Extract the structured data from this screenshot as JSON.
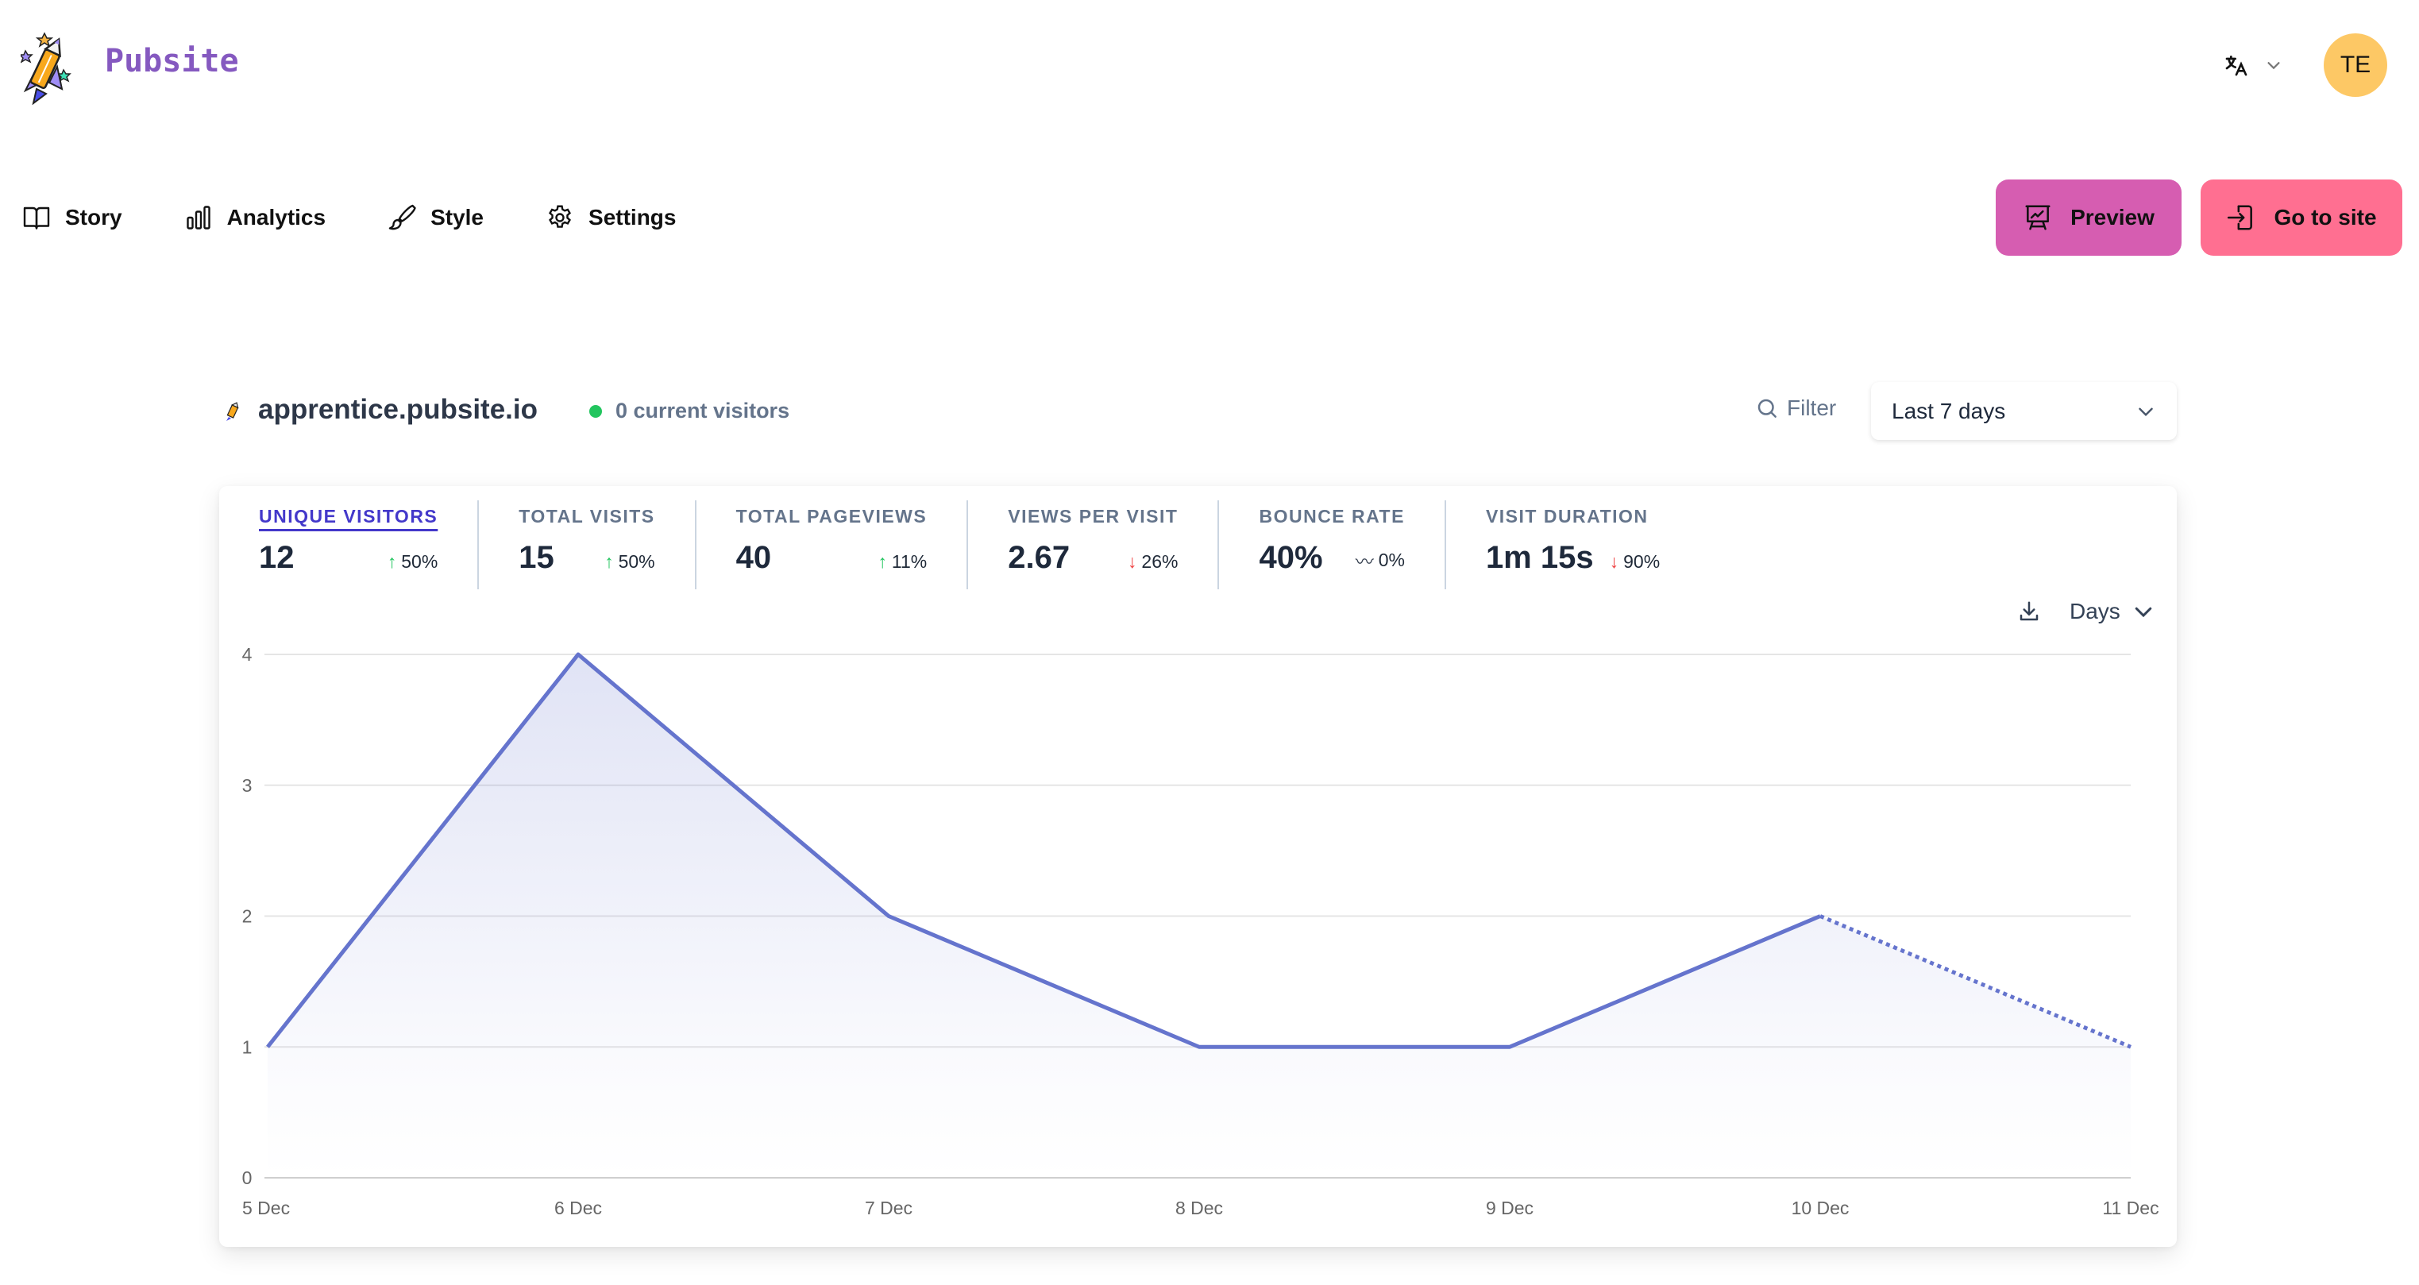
{
  "header": {
    "brand": "Pubsite",
    "language_icon": "translate-icon",
    "avatar_initials": "TE",
    "avatar_color": "#fdc865",
    "brand_color": "#8559c0"
  },
  "nav": {
    "items": [
      {
        "label": "Story",
        "icon": "book-open-icon"
      },
      {
        "label": "Analytics",
        "icon": "bar-chart-icon"
      },
      {
        "label": "Style",
        "icon": "paint-brush-icon"
      },
      {
        "label": "Settings",
        "icon": "gear-icon"
      }
    ],
    "preview_label": "Preview",
    "goto_label": "Go to site",
    "preview_color": "#d65db1",
    "goto_color": "#ff6f91"
  },
  "site": {
    "domain": "apprentice.pubsite.io",
    "current_visitors": "0 current visitors",
    "filter_label": "Filter",
    "period": "Last 7 days"
  },
  "stats": [
    {
      "label": "UNIQUE VISITORS",
      "value": "12",
      "direction": "up",
      "change": "50%",
      "active": true
    },
    {
      "label": "TOTAL VISITS",
      "value": "15",
      "direction": "up",
      "change": "50%",
      "active": false
    },
    {
      "label": "TOTAL PAGEVIEWS",
      "value": "40",
      "direction": "up",
      "change": "11%",
      "active": false
    },
    {
      "label": "VIEWS PER VISIT",
      "value": "2.67",
      "direction": "down",
      "change": "26%",
      "active": false
    },
    {
      "label": "BOUNCE RATE",
      "value": "40%",
      "direction": "flat",
      "change": "0%",
      "active": false
    },
    {
      "label": "VISIT DURATION",
      "value": "1m 15s",
      "direction": "down",
      "change": "90%",
      "active": false
    }
  ],
  "chart_controls": {
    "interval": "Days",
    "download_icon": "download-icon"
  },
  "chart_data": {
    "type": "line",
    "title": "",
    "xlabel": "",
    "ylabel": "",
    "categories": [
      "5 Dec",
      "6 Dec",
      "7 Dec",
      "8 Dec",
      "9 Dec",
      "10 Dec",
      "11 Dec"
    ],
    "series": [
      {
        "name": "Unique visitors",
        "values": [
          1,
          4,
          2,
          1,
          1,
          2,
          1
        ],
        "color": "#6574cd",
        "dashed_from_index": 5
      }
    ],
    "yticks": [
      0,
      1,
      2,
      3,
      4
    ],
    "ylim": [
      0,
      4
    ],
    "grid": true,
    "legend": "none"
  }
}
